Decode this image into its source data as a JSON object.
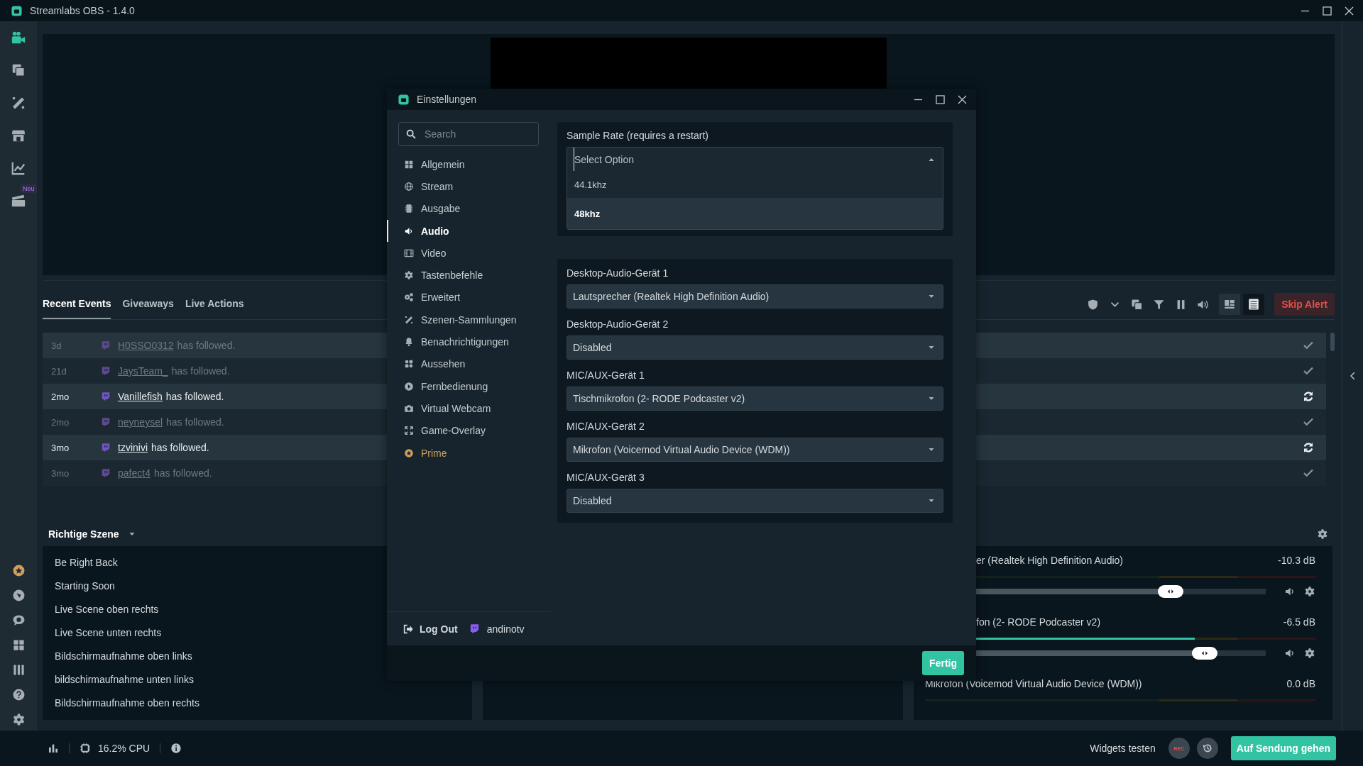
{
  "window": {
    "title": "Streamlabs OBS - 1.4.0"
  },
  "sidebar": {
    "top": [
      {
        "kind": "camera",
        "selected": true
      },
      {
        "kind": "layers",
        "selected": false
      },
      {
        "kind": "wand",
        "selected": false
      },
      {
        "kind": "store",
        "selected": false
      },
      {
        "kind": "chart",
        "selected": false
      },
      {
        "kind": "clapper",
        "selected": false,
        "badge": "Neu"
      }
    ],
    "bottom": [
      {
        "kind": "prime"
      },
      {
        "kind": "compass"
      },
      {
        "kind": "chat"
      },
      {
        "kind": "grid"
      },
      {
        "kind": "columns"
      },
      {
        "kind": "help"
      },
      {
        "kind": "gear"
      }
    ]
  },
  "events": {
    "tabs": [
      {
        "label": "Recent Events",
        "selected": true
      },
      {
        "label": "Giveaways",
        "selected": false
      },
      {
        "label": "Live Actions",
        "selected": false
      }
    ],
    "view_modes": [
      {
        "selected": false
      },
      {
        "selected": true
      }
    ],
    "skip_alert": "Skip Alert",
    "rows": [
      {
        "time": "3d",
        "user": "H0SSO0312",
        "text": "has followed.",
        "read": true
      },
      {
        "time": "21d",
        "user": "JaysTeam_",
        "text": "has followed.",
        "read": true
      },
      {
        "time": "2mo",
        "user": "Vanillefish",
        "text": "has followed.",
        "read": false
      },
      {
        "time": "2mo",
        "user": "neyneysel",
        "text": "has followed.",
        "read": true
      },
      {
        "time": "3mo",
        "user": "tzvinivi",
        "text": "has followed.",
        "read": false
      },
      {
        "time": "3mo",
        "user": "pafect4",
        "text": "has followed.",
        "read": true
      }
    ]
  },
  "scenes": {
    "collection": "Richtige Szene",
    "items": [
      "Be Right Back",
      "Starting Soon",
      "Live Scene oben rechts",
      "Live Scene unten rechts",
      "Bildschirmaufnahme oben links",
      "bildschirmaufnahme unten links",
      "Bildschirmaufnahme oben rechts"
    ]
  },
  "mixer": {
    "items": [
      {
        "name": "er (Realtek High Definition Audio)",
        "reading": "-10.3 dB",
        "volume": {
          "level": 0.72
        }
      },
      {
        "name": "fon (2- RODE Podcaster v2)",
        "reading": "-6.5 dB",
        "meter": {
          "level": 0.69
        },
        "volume": {
          "level": 0.82
        }
      },
      {
        "name": "Mikrofon (Voicemod Virtual Audio Device (WDM))",
        "reading": "0.0 dB"
      }
    ]
  },
  "settings": {
    "title": "Einstellungen",
    "search": {
      "placeholder": "Search"
    },
    "nav": [
      {
        "kind": "general",
        "label": "Allgemein",
        "selected": false
      },
      {
        "kind": "stream",
        "label": "Stream",
        "selected": false
      },
      {
        "kind": "output",
        "label": "Ausgabe",
        "selected": false
      },
      {
        "kind": "audio",
        "label": "Audio",
        "selected": true
      },
      {
        "kind": "video",
        "label": "Video",
        "selected": false
      },
      {
        "kind": "hotkeys",
        "label": "Tastenbefehle",
        "selected": false
      },
      {
        "kind": "advanced",
        "label": "Erweitert",
        "selected": false
      },
      {
        "kind": "scenes",
        "label": "Szenen-Sammlungen",
        "selected": false
      },
      {
        "kind": "notifications",
        "label": "Benachrichtigungen",
        "selected": false
      },
      {
        "kind": "appearance",
        "label": "Aussehen",
        "selected": false
      },
      {
        "kind": "remote",
        "label": "Fernbedienung",
        "selected": false
      },
      {
        "kind": "webcam",
        "label": "Virtual Webcam",
        "selected": false
      },
      {
        "kind": "overlay",
        "label": "Game-Overlay",
        "selected": false
      },
      {
        "kind": "prime",
        "label": "Prime",
        "selected": false
      }
    ],
    "logout": "Log Out",
    "account": "andinotv",
    "sample_rate": {
      "label": "Sample Rate (requires a restart)",
      "placeholder": "Select Option",
      "options": [
        {
          "label": "44.1khz",
          "selected": false
        },
        {
          "label": "48khz",
          "selected": true
        }
      ]
    },
    "devices": [
      {
        "label": "Desktop-Audio-Gerät 1",
        "value": "Lautsprecher (Realtek High Definition Audio)"
      },
      {
        "label": "Desktop-Audio-Gerät 2",
        "value": "Disabled"
      },
      {
        "label": "MIC/AUX-Gerät 1",
        "value": "Tischmikrofon (2- RODE Podcaster v2)"
      },
      {
        "label": "MIC/AUX-Gerät 2",
        "value": "Mikrofon (Voicemod Virtual Audio Device (WDM))"
      },
      {
        "label": "MIC/AUX-Gerät 3",
        "value": "Disabled"
      }
    ],
    "done": "Fertig"
  },
  "status_bar": {
    "cpu": "16.2% CPU",
    "widgets": "Widgets testen",
    "rec": "REC",
    "go_live": "Auf Sendung gehen"
  }
}
